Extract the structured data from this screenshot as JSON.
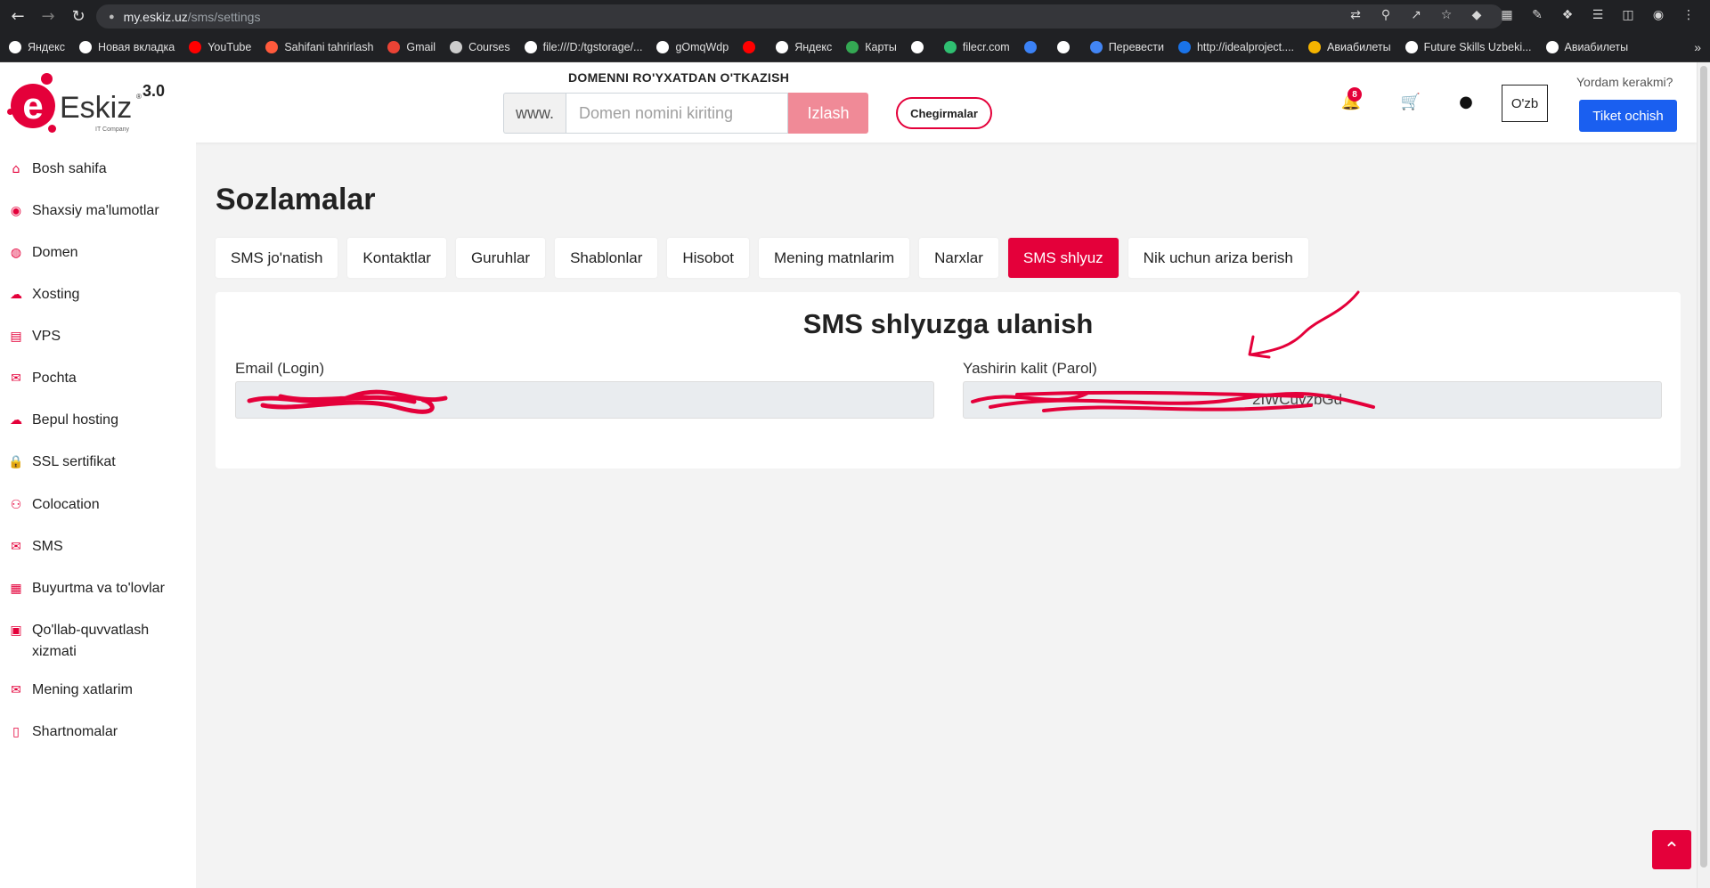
{
  "browser": {
    "url_host": "my.eskiz.uz",
    "url_path": "/sms/settings",
    "bookmarks": [
      {
        "label": "Яндекс",
        "color": "#ffffff"
      },
      {
        "label": "Новая вкладка",
        "color": "#ffffff"
      },
      {
        "label": "YouTube",
        "color": "#ff0000"
      },
      {
        "label": "Sahifani tahrirlash",
        "color": "#ff5a3c"
      },
      {
        "label": "Gmail",
        "color": "#ea4335"
      },
      {
        "label": "Courses",
        "color": "#cccccc"
      },
      {
        "label": "file:///D:/tgstorage/...",
        "color": "#ffffff"
      },
      {
        "label": "gOmqWdp",
        "color": "#ffffff"
      },
      {
        "label": "",
        "color": "#ff0000"
      },
      {
        "label": "Яндекс",
        "color": "#ffffff"
      },
      {
        "label": "Карты",
        "color": "#34a853"
      },
      {
        "label": "",
        "color": "#ffffff"
      },
      {
        "label": "filecr.com",
        "color": "#2fbf71"
      },
      {
        "label": "",
        "color": "#3b82f6"
      },
      {
        "label": "",
        "color": "#ffffff"
      },
      {
        "label": "Перевести",
        "color": "#4285f4"
      },
      {
        "label": "http://idealproject....",
        "color": "#1a73e8"
      },
      {
        "label": "Авиабилеты",
        "color": "#f5b400"
      },
      {
        "label": "Future Skills Uzbeki...",
        "color": "#ffffff"
      },
      {
        "label": "Авиабилеты",
        "color": "#ffffff"
      }
    ]
  },
  "header": {
    "domain_title": "DOMENNI RO'YXATDAN O'TKAZISH",
    "www_prefix": "www.",
    "domain_placeholder": "Domen nomini kiriting",
    "search_button": "Izlash",
    "discounts_button": "Chegirmalar",
    "notification_count": "8",
    "language": "O'zb",
    "help_text": "Yordam kerakmi?",
    "ticket_button": "Tiket ochish",
    "logo_name": "Eskiz",
    "logo_version": "3.0",
    "logo_sub": "IT Company"
  },
  "sidebar": {
    "items": [
      {
        "label": "Bosh sahifa",
        "icon": "home-icon"
      },
      {
        "label": "Shaxsiy ma'lumotlar",
        "icon": "user-circle-icon"
      },
      {
        "label": "Domen",
        "icon": "globe-icon"
      },
      {
        "label": "Xosting",
        "icon": "cloud-icon"
      },
      {
        "label": "VPS",
        "icon": "server-icon"
      },
      {
        "label": "Pochta",
        "icon": "mail-icon"
      },
      {
        "label": "Bepul hosting",
        "icon": "cloud-outline-icon"
      },
      {
        "label": "SSL sertifikat",
        "icon": "lock-icon"
      },
      {
        "label": "Colocation",
        "icon": "network-icon"
      },
      {
        "label": "SMS",
        "icon": "envelope-icon"
      },
      {
        "label": "Buyurtma va to'lovlar",
        "icon": "calculator-icon"
      },
      {
        "label": "Qo'llab-quvvatlash xizmati",
        "icon": "chat-icon"
      },
      {
        "label": "Mening xatlarim",
        "icon": "envelope-icon"
      },
      {
        "label": "Shartnomalar",
        "icon": "clipboard-icon"
      }
    ]
  },
  "main": {
    "title": "Sozlamalar",
    "tabs": [
      {
        "label": "SMS jo'natish",
        "active": false
      },
      {
        "label": "Kontaktlar",
        "active": false
      },
      {
        "label": "Guruhlar",
        "active": false
      },
      {
        "label": "Shablonlar",
        "active": false
      },
      {
        "label": "Hisobot",
        "active": false
      },
      {
        "label": "Mening matnlarim",
        "active": false
      },
      {
        "label": "Narxlar",
        "active": false
      },
      {
        "label": "SMS shlyuz",
        "active": true
      },
      {
        "label": "Nik uchun ariza berish",
        "active": false
      }
    ],
    "card": {
      "title": "SMS shlyuzga ulanish",
      "email_label": "Email (Login)",
      "email_value": "",
      "key_label": "Yashirin kalit (Parol)",
      "key_value_visible": "2IWCuvzbGd"
    }
  },
  "colors": {
    "brand": "#e4003a",
    "ticket_blue": "#1a5ff0",
    "search_pink": "#f08a97"
  }
}
